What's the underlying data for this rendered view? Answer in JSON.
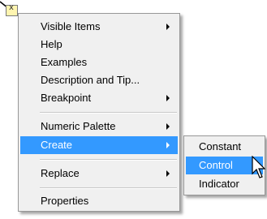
{
  "menu": {
    "items": [
      {
        "label": "Visible Items",
        "has_submenu": true
      },
      {
        "label": "Help",
        "has_submenu": false
      },
      {
        "label": "Examples",
        "has_submenu": false
      },
      {
        "label": "Description and Tip...",
        "has_submenu": false
      },
      {
        "label": "Breakpoint",
        "has_submenu": true
      },
      {
        "label": "Numeric Palette",
        "has_submenu": true
      },
      {
        "label": "Create",
        "has_submenu": true,
        "highlighted": true
      },
      {
        "label": "Replace",
        "has_submenu": true
      },
      {
        "label": "Properties",
        "has_submenu": false
      }
    ]
  },
  "submenu": {
    "items": [
      {
        "label": "Constant"
      },
      {
        "label": "Control",
        "highlighted": true
      },
      {
        "label": "Indicator"
      }
    ]
  },
  "colors": {
    "highlight": "#3399ff",
    "menu_bg": "#f0f0f0",
    "terminal_fill": "#fff5b0"
  },
  "icons": [
    "wire-terminal-icon",
    "submenu-arrow-icon",
    "mouse-pointer-icon"
  ]
}
